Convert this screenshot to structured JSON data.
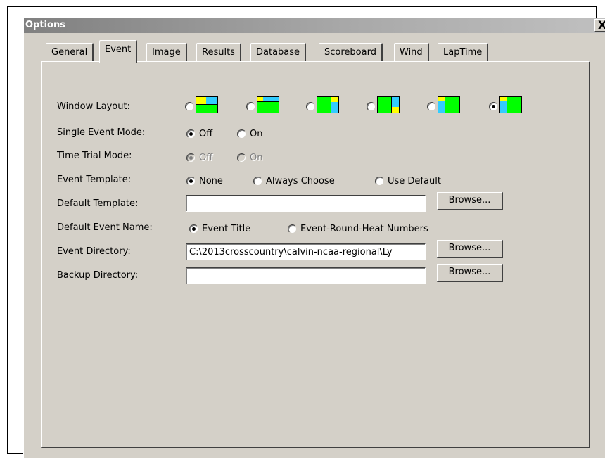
{
  "window": {
    "title": "Options",
    "close_glyph": "X"
  },
  "tabs": [
    {
      "label": "General"
    },
    {
      "label": "Event",
      "active": true
    },
    {
      "label": "Image"
    },
    {
      "label": "Results"
    },
    {
      "label": "Database"
    },
    {
      "label": "Scoreboard"
    },
    {
      "label": "Wind"
    },
    {
      "label": "LapTime"
    }
  ],
  "event_tab": {
    "window_layout": {
      "label": "Window Layout:",
      "selected_index": 5,
      "icons": [
        "layout-1-icon",
        "layout-2-icon",
        "layout-3-icon",
        "layout-4-icon",
        "layout-5-icon",
        "layout-6-icon"
      ]
    },
    "single_event_mode": {
      "label": "Single Event Mode:",
      "options": [
        "Off",
        "On"
      ],
      "selected": "Off"
    },
    "time_trial_mode": {
      "label": "Time Trial Mode:",
      "options": [
        "Off",
        "On"
      ],
      "selected": "Off",
      "disabled": true
    },
    "event_template": {
      "label": "Event Template:",
      "options": [
        "None",
        "Always Choose",
        "Use Default"
      ],
      "selected": "None"
    },
    "default_template": {
      "label": "Default Template:",
      "value": "",
      "browse_label": "Browse..."
    },
    "default_event_name": {
      "label": "Default Event Name:",
      "options": [
        "Event Title",
        "Event-Round-Heat Numbers"
      ],
      "selected": "Event Title"
    },
    "event_directory": {
      "label": "Event Directory:",
      "value": "C:\\2013crosscountry\\calvin-ncaa-regional\\Ly",
      "browse_label": "Browse..."
    },
    "backup_directory": {
      "label": "Backup Directory:",
      "value": "",
      "browse_label": "Browse..."
    }
  },
  "colors": {
    "face": "#d4d0c8",
    "layout_green": "#00ff00",
    "layout_cyan": "#33ccff",
    "layout_yellow": "#ffff00"
  }
}
